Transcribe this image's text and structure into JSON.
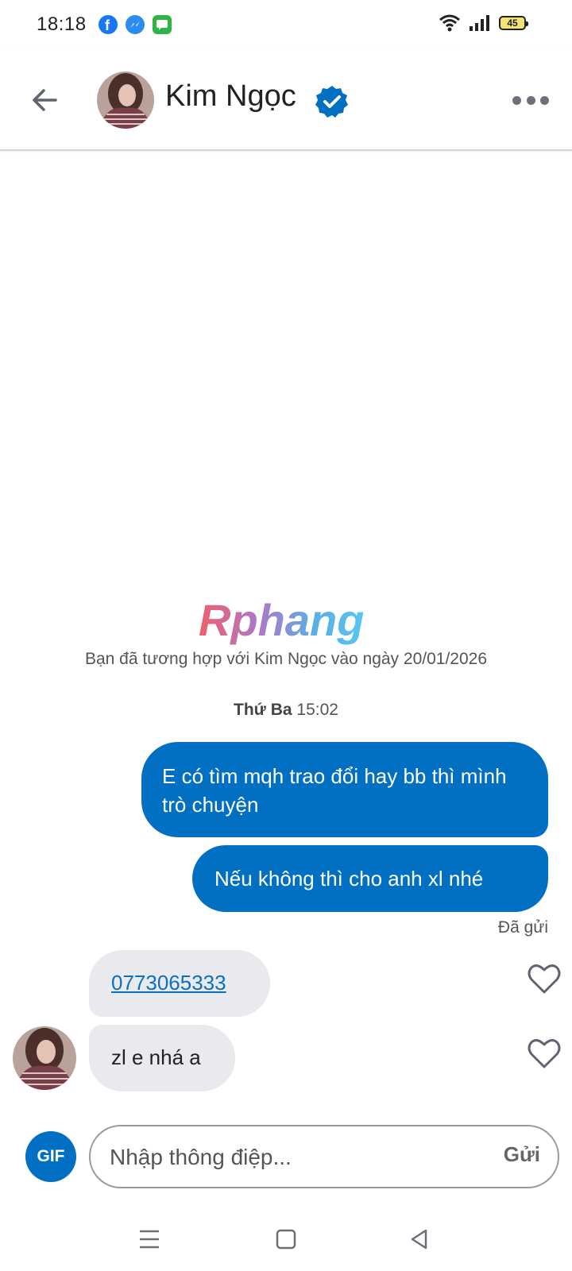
{
  "status_bar": {
    "time": "18:18",
    "battery": "45",
    "apps": [
      "facebook-icon",
      "messenger-icon",
      "messages-icon"
    ]
  },
  "header": {
    "contact_name": "Kim Ngọc",
    "verified": true
  },
  "brand": {
    "logo_text": "Rphang",
    "accent": "#0170c2"
  },
  "conversation": {
    "match_notice": "Bạn đã tương hợp với Kim Ngọc vào ngày 20/01/2026",
    "date_day": "Thứ Ba",
    "date_time": "15:02",
    "messages_out": [
      {
        "text": "E có tìm mqh trao đổi hay bb thì mình trò chuyện"
      },
      {
        "text": "Nếu không thì cho anh xl nhé"
      }
    ],
    "sent_status": "Đã gửi",
    "messages_in": [
      {
        "text": "0773065333",
        "is_link": true
      },
      {
        "text": "zl e nhá a"
      }
    ]
  },
  "composer": {
    "gif_label": "GIF",
    "placeholder": "Nhập thông điệp...",
    "send_label": "Gửi"
  }
}
